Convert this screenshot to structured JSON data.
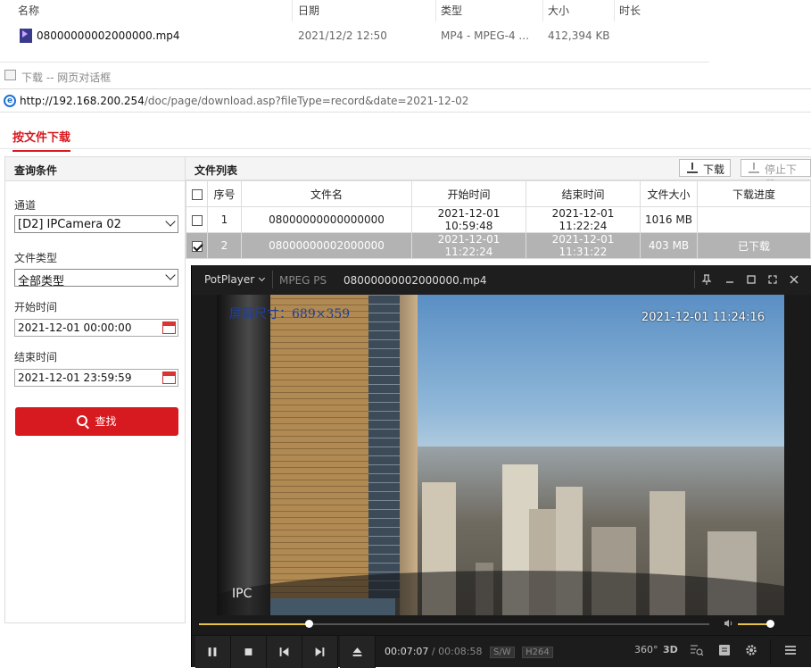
{
  "explorer": {
    "columns": [
      "名称",
      "日期",
      "类型",
      "大小",
      "时长"
    ],
    "file": {
      "name": "08000000002000000.mp4",
      "date": "2021/12/2 12:50",
      "type": "MP4 - MPEG-4 ...",
      "size": "412,394 KB",
      "icon": "mp4-file-icon"
    }
  },
  "dialog": {
    "title": "下载 -- 网页对话框",
    "url_host": "http://192.168.200.254",
    "url_path": "/doc/page/download.asp?fileType=record&date=2021-12-02"
  },
  "tab": {
    "label": "按文件下载",
    "color": "#d71920"
  },
  "query": {
    "header": "查询条件",
    "channel_label": "通道",
    "channel_value": "[D2] IPCamera 02",
    "filetype_label": "文件类型",
    "filetype_value": "全部类型",
    "start_label": "开始时间",
    "start_value": "2021-12-01 00:00:00",
    "end_label": "结束时间",
    "end_value": "2021-12-01 23:59:59",
    "search_label": "查找"
  },
  "file_list": {
    "header": "文件列表",
    "download_label": "下载",
    "stop_label": "停止下载",
    "columns": [
      "序号",
      "文件名",
      "开始时间",
      "结束时间",
      "文件大小",
      "下载进度"
    ],
    "rows": [
      {
        "index": "1",
        "name": "08000000000000000",
        "start": "2021-12-01 10:59:48",
        "end": "2021-12-01 11:22:24",
        "size": "1016 MB",
        "progress": "",
        "checked": false,
        "selected": false
      },
      {
        "index": "2",
        "name": "08000000002000000",
        "start": "2021-12-01 11:22:24",
        "end": "2021-12-01 11:31:22",
        "size": "403 MB",
        "progress": "已下载",
        "checked": true,
        "selected": true
      }
    ]
  },
  "player": {
    "brand": "PotPlayer",
    "format": "MPEG PS",
    "filename": "08000000002000000.mp4",
    "osd_size": "屏幕尺寸：689×359",
    "osd_time": "2021-12-01 11:24:16",
    "osd_ipc": "IPC",
    "time_current": "00:07:07",
    "time_sep": " / ",
    "time_total": "00:08:58",
    "tag_sw": "S/W",
    "tag_codec": "H264",
    "progress_fraction": 0.2145,
    "volume_fraction": 0.9,
    "accent": "#e8c245",
    "right_icons": [
      "360°",
      "3D"
    ]
  }
}
